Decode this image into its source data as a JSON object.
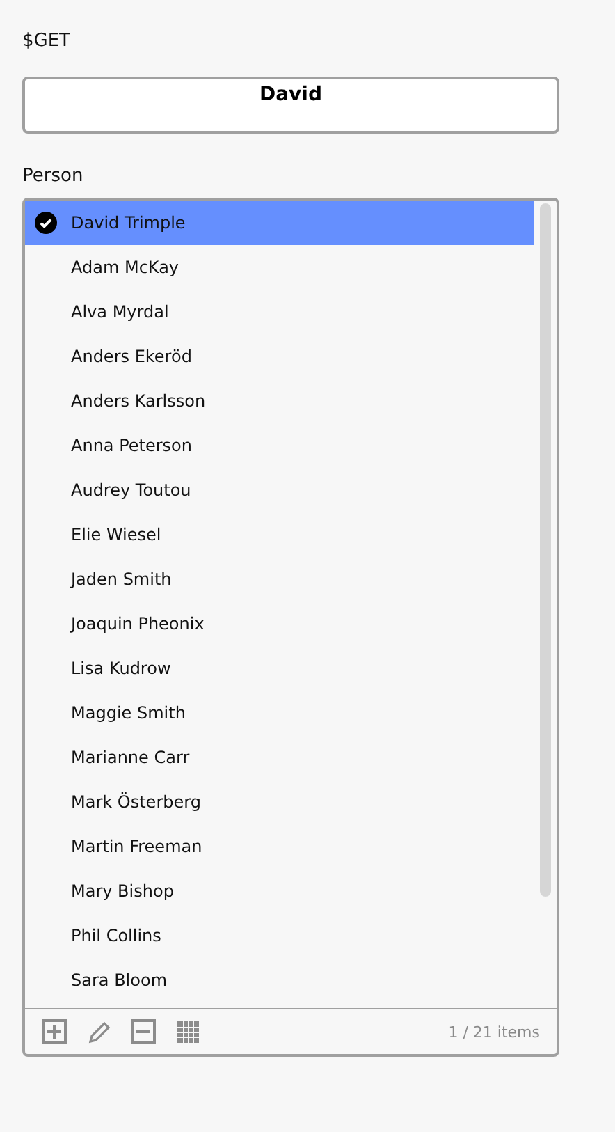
{
  "get_label": "$GET",
  "get_field": {
    "value": "David"
  },
  "person_label": "Person",
  "people": [
    {
      "name": "David Trimple",
      "selected": true
    },
    {
      "name": "Adam McKay",
      "selected": false
    },
    {
      "name": "Alva Myrdal",
      "selected": false
    },
    {
      "name": "Anders Ekeröd",
      "selected": false
    },
    {
      "name": "Anders Karlsson",
      "selected": false
    },
    {
      "name": "Anna Peterson",
      "selected": false
    },
    {
      "name": "Audrey Toutou",
      "selected": false
    },
    {
      "name": "Elie Wiesel",
      "selected": false
    },
    {
      "name": "Jaden Smith",
      "selected": false
    },
    {
      "name": "Joaquin Pheonix",
      "selected": false
    },
    {
      "name": "Lisa Kudrow",
      "selected": false
    },
    {
      "name": "Maggie Smith",
      "selected": false
    },
    {
      "name": "Marianne Carr",
      "selected": false
    },
    {
      "name": "Mark Österberg",
      "selected": false
    },
    {
      "name": "Martin Freeman",
      "selected": false
    },
    {
      "name": "Mary Bishop",
      "selected": false
    },
    {
      "name": "Phil Collins",
      "selected": false
    },
    {
      "name": "Sara Bloom",
      "selected": false
    }
  ],
  "item_count": "1 / 21 items"
}
